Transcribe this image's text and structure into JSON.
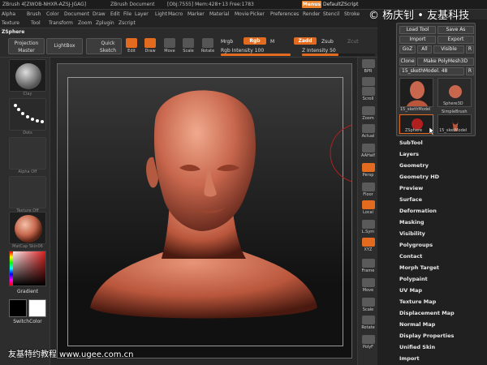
{
  "titlebar": {
    "app": "ZBrush 4[ZWOB-NHXR-AZSJ-JGAG]",
    "document": "ZBrush Document",
    "stats": "[Obj:7555] Mem:428+13 Free:1783",
    "menus_label": "Menus",
    "script_label": "DefaultZScript"
  },
  "watermark_top": "© 杨庆钊 • 友基科技",
  "watermark_bottom": "友基特约教程 www.ugee.com.cn",
  "menubar": {
    "row1": [
      "Alpha",
      "Brush",
      "Color",
      "Document",
      "Draw",
      "Edit",
      "File",
      "Layer",
      "Light",
      "Macro",
      "Marker",
      "Material",
      "Movie",
      "Picker",
      "Preferences",
      "Render",
      "Stencil",
      "Stroke"
    ],
    "row2": [
      "Texture",
      "Tool",
      "Transform",
      "Zoom",
      "Zplugin",
      "Zscript"
    ]
  },
  "toolbar": {
    "zsphere_label": "ZSphere",
    "projection_master": "Projection Master",
    "lightbox": "LightBox",
    "quick_sketch": "Quick Sketch",
    "edit": "Edit",
    "draw": "Draw",
    "move": "Move",
    "scale": "Scale",
    "rotate": "Rotate",
    "mrgb": "Mrgb",
    "rgb": "Rgb",
    "m": "M",
    "zadd": "Zadd",
    "zsub": "Zsub",
    "zcut": "Zcut",
    "rgb_intensity_label": "Rgb Intensity",
    "rgb_intensity_value": "100",
    "rgb_intensity_fraction": 1.0,
    "z_intensity_label": "Z Intensity",
    "z_intensity_value": "50",
    "z_intensity_fraction": 0.5
  },
  "left_shelf": {
    "items": [
      {
        "label": "Clay"
      },
      {
        "label": "Dots"
      },
      {
        "label": "Alpha Off"
      },
      {
        "label": "Texture Off"
      },
      {
        "label": "MatCap Skin06"
      }
    ],
    "gradient_label": "Gradient",
    "switchcolor_label": "SwitchColor"
  },
  "right_strip": {
    "items": [
      "BPR",
      "SPix",
      "Scroll",
      "Zoom",
      "Actual",
      "AAHalf",
      "Persp",
      "Floor",
      "Local",
      "L.Sym",
      "XYZ",
      "Frame",
      "Move",
      "Scale",
      "Rotate",
      "PolyF"
    ]
  },
  "tool_panel": {
    "load_tool": "Load Tool",
    "save_as": "Save As",
    "import": "Import",
    "export": "Export",
    "goz": "GoZ",
    "all": "All",
    "visible": "Visible",
    "r": "R",
    "clone": "Clone",
    "make_polymesh": "Make PolyMesh3D",
    "current_tool": "15_skethModel. 48",
    "thumbs": [
      "15_skethModel",
      "Sphere3D",
      "SimpleBrush",
      "ZSphere",
      "15_sketModel"
    ]
  },
  "subpalettes": [
    "SubTool",
    "Layers",
    "Geometry",
    "Geometry HD",
    "Preview",
    "Surface",
    "Deformation",
    "Masking",
    "Visibility",
    "Polygroups",
    "Contact",
    "Morph Target",
    "Polypaint",
    "UV Map",
    "Texture Map",
    "Displacement Map",
    "Normal Map",
    "Display Properties",
    "Unified Skin",
    "Import"
  ],
  "colors": {
    "accent": "#e36b1f",
    "panel": "#2d2d2d",
    "model": "#c8674d"
  }
}
